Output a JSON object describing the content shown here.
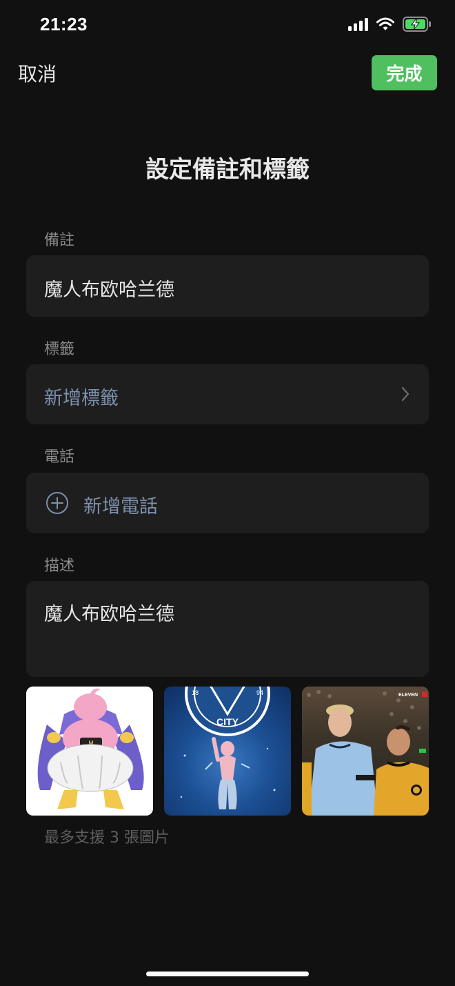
{
  "status_bar": {
    "time": "21:23"
  },
  "nav": {
    "cancel_label": "取消",
    "done_label": "完成"
  },
  "title": "設定備註和標籤",
  "remark": {
    "label": "備註",
    "value": "魔人布欧哈兰德"
  },
  "tags": {
    "label": "標籤",
    "add_label": "新增標籤"
  },
  "phone": {
    "label": "電話",
    "add_label": "新增電話"
  },
  "description": {
    "label": "描述",
    "value": "魔人布欧哈兰德"
  },
  "images": {
    "items": [
      {
        "name": "majin-buu-image"
      },
      {
        "name": "man-city-buu-image"
      },
      {
        "name": "football-player-image",
        "overlay_text": "ELEVEN"
      }
    ],
    "hint": "最多支援 3 張圖片"
  },
  "colors": {
    "accent": "#4fbf5f",
    "background": "#111111",
    "field": "#1e1e1e",
    "link": "#7d90ad"
  }
}
